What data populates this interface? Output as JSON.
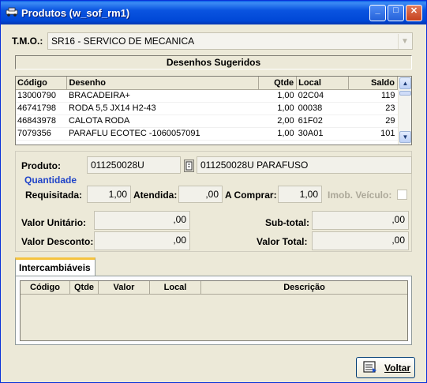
{
  "window": {
    "title": "Produtos (w_sof_rm1)",
    "btn_minimize": "_",
    "btn_maximize": "□",
    "btn_close": "✕"
  },
  "tmo": {
    "label": "T.M.O.:",
    "value": "SR16 - SERVICO DE MECANICA"
  },
  "desenhos": {
    "title": "Desenhos Sugeridos",
    "columns": {
      "codigo": "Código",
      "desenho": "Desenho",
      "qtde": "Qtde",
      "local": "Local",
      "saldo": "Saldo"
    },
    "rows": [
      {
        "codigo": "13000790",
        "desenho": "BRACADEIRA+",
        "qtde": "1,00",
        "local": "02C04",
        "saldo": "119"
      },
      {
        "codigo": "46741798",
        "desenho": "RODA 5,5 JX14 H2-43",
        "qtde": "1,00",
        "local": "00038",
        "saldo": "23"
      },
      {
        "codigo": "46843978",
        "desenho": "CALOTA RODA",
        "qtde": "2,00",
        "local": "61F02",
        "saldo": "29"
      },
      {
        "codigo": "7079356",
        "desenho": "PARAFLU ECOTEC -1060057091",
        "qtde": "1,00",
        "local": "30A01",
        "saldo": "101"
      }
    ]
  },
  "produto": {
    "label": "Produto:",
    "codigo": "011250028U",
    "descricao": "011250028U PARAFUSO",
    "quantidade_title": "Quantidade",
    "requisitada_label": "Requisitada:",
    "requisitada": "1,00",
    "atendida_label": "Atendida:",
    "atendida": ",00",
    "a_comprar_label": "A Comprar:",
    "a_comprar": "1,00",
    "imob_label": "Imob. Veículo:"
  },
  "valores": {
    "unitario_label": "Valor Unitário:",
    "unitario": ",00",
    "desconto_label": "Valor Desconto:",
    "desconto": ",00",
    "subtotal_label": "Sub-total:",
    "subtotal": ",00",
    "total_label": "Valor Total:",
    "total": ",00"
  },
  "intercambiaveis": {
    "tab": "Intercambiáveis",
    "columns": {
      "codigo": "Código",
      "qtde": "Qtde",
      "valor": "Valor",
      "local": "Local",
      "descricao": "Descrição"
    }
  },
  "buttons": {
    "voltar": "Voltar"
  }
}
